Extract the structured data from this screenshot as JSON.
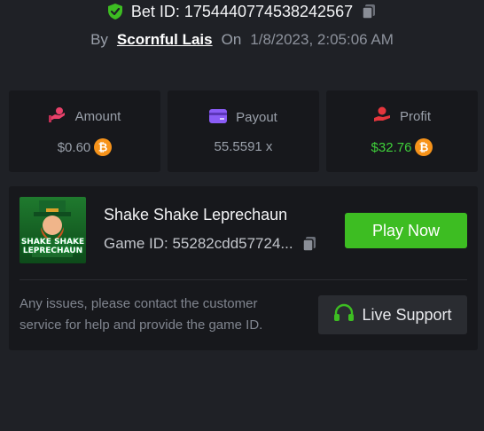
{
  "bet": {
    "id_label": "Bet ID: 1754440774538242567",
    "by_label": "By",
    "username": "Scornful Lais",
    "on_label": "On",
    "date": "1/8/2023, 2:05:06 AM"
  },
  "stats": {
    "amount": {
      "label": "Amount",
      "value": "$0.60",
      "icon": "coin-hand-icon"
    },
    "payout": {
      "label": "Payout",
      "value": "55.5591 x",
      "icon": "card-icon"
    },
    "profit": {
      "label": "Profit",
      "value": "$32.76",
      "icon": "hand-coin-icon"
    }
  },
  "game": {
    "title": "Shake Shake Leprechaun",
    "id_text": "Game ID: 55282cdd57724...",
    "thumb_text_line1": "SHAKE SHAKE",
    "thumb_text_line2": "LEPRECHAUN",
    "play_label": "Play Now"
  },
  "support": {
    "notice": "Any issues, please contact the customer service for help and provide the game ID.",
    "button_label": "Live Support"
  },
  "colors": {
    "accent_green": "#3dbd22",
    "profit_green": "#3fcf3a",
    "btc_orange": "#f7931a",
    "amount_pink": "#e8416a",
    "payout_purple": "#8a5cf6",
    "profit_red": "#e5363d"
  }
}
